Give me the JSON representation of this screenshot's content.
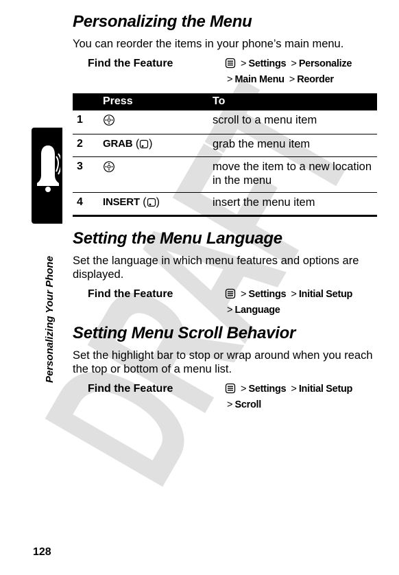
{
  "watermark": "DRAFT",
  "side_label": "Personalizing Your Phone",
  "page_number": "128",
  "sections": {
    "s1": {
      "title": "Personalizing the Menu",
      "body": "You can reorder the items in your phone’s main menu."
    },
    "s2": {
      "title": "Setting the Menu Language",
      "body": "Set the language in which menu features and options are displayed."
    },
    "s3": {
      "title": "Setting Menu Scroll Behavior",
      "body": "Set the highlight bar to stop or wrap around when you reach the top or bottom of a menu list."
    }
  },
  "ftf_label": "Find the Feature",
  "gt": ">",
  "path": {
    "settings": "Settings",
    "personalize": "Personalize",
    "mainmenu": "Main Menu",
    "reorder": "Reorder",
    "initialsetup": "Initial Setup",
    "language": "Language",
    "scroll": "Scroll"
  },
  "table": {
    "headers": {
      "press": "Press",
      "to": "To"
    },
    "rows": [
      {
        "n": "1",
        "press_label": "",
        "press_type": "nav",
        "to": "scroll to a menu item"
      },
      {
        "n": "2",
        "press_label": "GRAB",
        "press_type": "softleft",
        "to": "grab the menu item"
      },
      {
        "n": "3",
        "press_label": "",
        "press_type": "nav",
        "to": "move the item to a new location in the menu"
      },
      {
        "n": "4",
        "press_label": "INSERT",
        "press_type": "softleft",
        "to": "insert the menu item"
      }
    ]
  }
}
